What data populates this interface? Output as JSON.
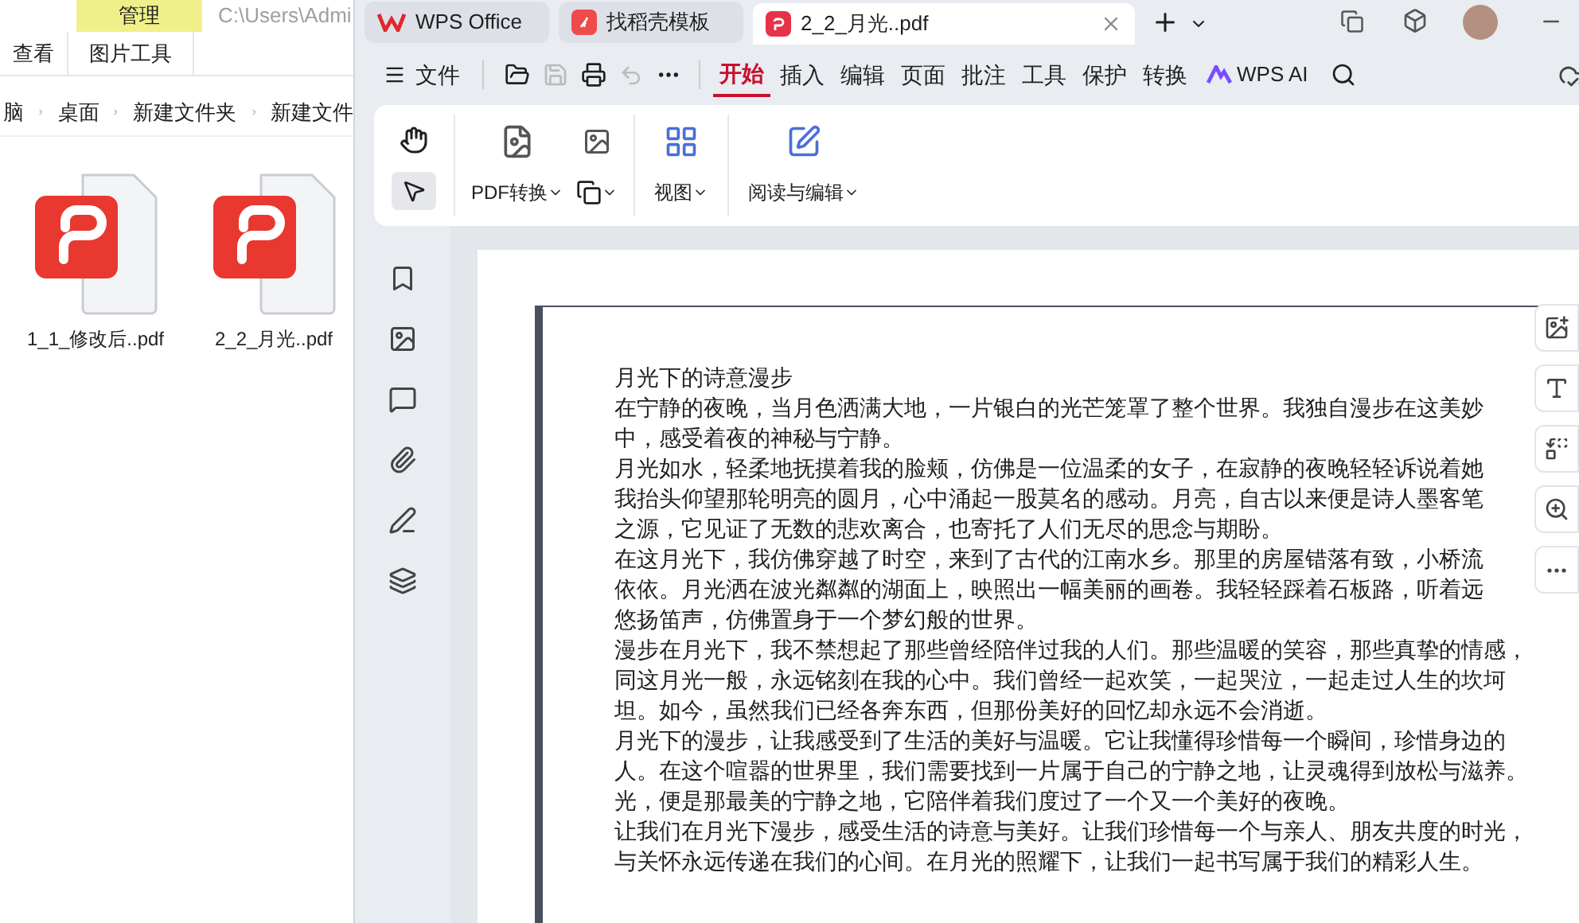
{
  "explorer": {
    "context_tab": "管理",
    "path": "C:\\Users\\Admi",
    "ribbon_tabs": [
      {
        "label": "查看"
      },
      {
        "label": "图片工具"
      }
    ],
    "breadcrumb": [
      "脑",
      "桌面",
      "新建文件夹",
      "新建文件"
    ],
    "files": [
      {
        "name": "1_1_修改后..pdf"
      },
      {
        "name": "2_2_月光..pdf"
      }
    ]
  },
  "wps": {
    "tabs": [
      {
        "label": "WPS Office",
        "kind": "home",
        "selected": false
      },
      {
        "label": "找稻壳模板",
        "kind": "template",
        "selected": false
      },
      {
        "label": "2_2_月光..pdf",
        "kind": "pdf",
        "selected": true
      }
    ],
    "file_menu": "文件",
    "menu": [
      {
        "label": "开始",
        "selected": true
      },
      {
        "label": "插入",
        "selected": false
      },
      {
        "label": "编辑",
        "selected": false
      },
      {
        "label": "页面",
        "selected": false
      },
      {
        "label": "批注",
        "selected": false
      },
      {
        "label": "工具",
        "selected": false
      },
      {
        "label": "保护",
        "selected": false
      },
      {
        "label": "转换",
        "selected": false
      }
    ],
    "ai_label": "WPS AI",
    "tools": [
      {
        "kind": "hand",
        "selected": false
      },
      {
        "kind": "select",
        "selected": true
      }
    ],
    "pdf_convert": "PDF转换",
    "view": "视图",
    "read_edit": "阅读与编辑",
    "document": {
      "lines": [
        "月光下的诗意漫步",
        "在宁静的夜晚，当月色洒满大地，一片银白的光芒笼罩了整个世界。我独自漫步在这美妙",
        "中，感受着夜的神秘与宁静。",
        "月光如水，轻柔地抚摸着我的脸颊，仿佛是一位温柔的女子，在寂静的夜晚轻轻诉说着她",
        "我抬头仰望那轮明亮的圆月，心中涌起一股莫名的感动。月亮，自古以来便是诗人墨客笔",
        "之源，它见证了无数的悲欢离合，也寄托了人们无尽的思念与期盼。",
        "在这月光下，我仿佛穿越了时空，来到了古代的江南水乡。那里的房屋错落有致，小桥流",
        "依依。月光洒在波光粼粼的湖面上，映照出一幅美丽的画卷。我轻轻踩着石板路，听着远",
        "悠扬笛声，仿佛置身于一个梦幻般的世界。",
        "漫步在月光下，我不禁想起了那些曾经陪伴过我的人们。那些温暖的笑容，那些真挚的情感，",
        "同这月光一般，永远铭刻在我的心中。我们曾经一起欢笑，一起哭泣，一起走过人生的坎坷",
        "坦。如今，虽然我们已经各奔东西，但那份美好的回忆却永远不会消逝。",
        "月光下的漫步，让我感受到了生活的美好与温暖。它让我懂得珍惜每一个瞬间，珍惜身边的",
        "人。在这个喧嚣的世界里，我们需要找到一片属于自己的宁静之地，让灵魂得到放松与滋养。",
        "光，便是那最美的宁静之地，它陪伴着我们度过了一个又一个美好的夜晚。",
        "让我们在月光下漫步，感受生活的诗意与美好。让我们珍惜每一个与亲人、朋友共度的时光，",
        "与关怀永远传递在我们的心间。在月光的照耀下，让我们一起书写属于我们的精彩人生。"
      ]
    }
  }
}
